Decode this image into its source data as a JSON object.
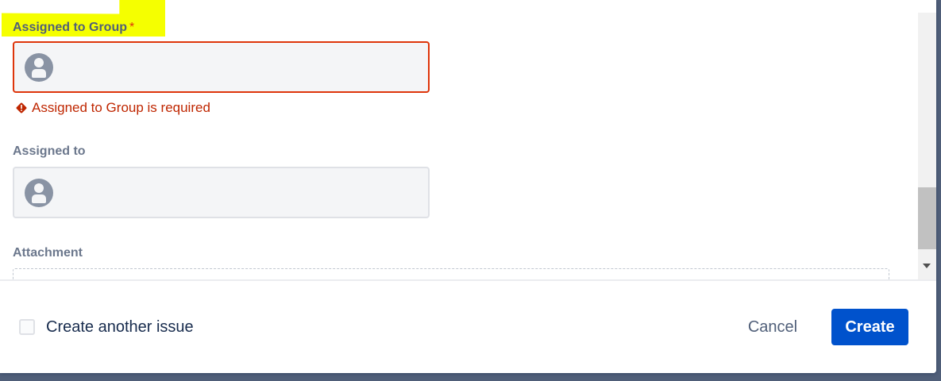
{
  "form": {
    "assigned_group": {
      "label": "Assigned to Group",
      "required_mark": "*",
      "error": "Assigned to Group is required"
    },
    "assigned_to": {
      "label": "Assigned to"
    },
    "attachment": {
      "label": "Attachment"
    }
  },
  "footer": {
    "create_another_label": "Create another issue",
    "create_another_checked": false,
    "cancel_label": "Cancel",
    "create_label": "Create"
  },
  "colors": {
    "error": "#de350b",
    "primary": "#0052cc",
    "highlight": "#f5ff00"
  },
  "icons": [
    "user-avatar-icon",
    "error-diamond-icon",
    "scroll-down-arrow-icon"
  ]
}
